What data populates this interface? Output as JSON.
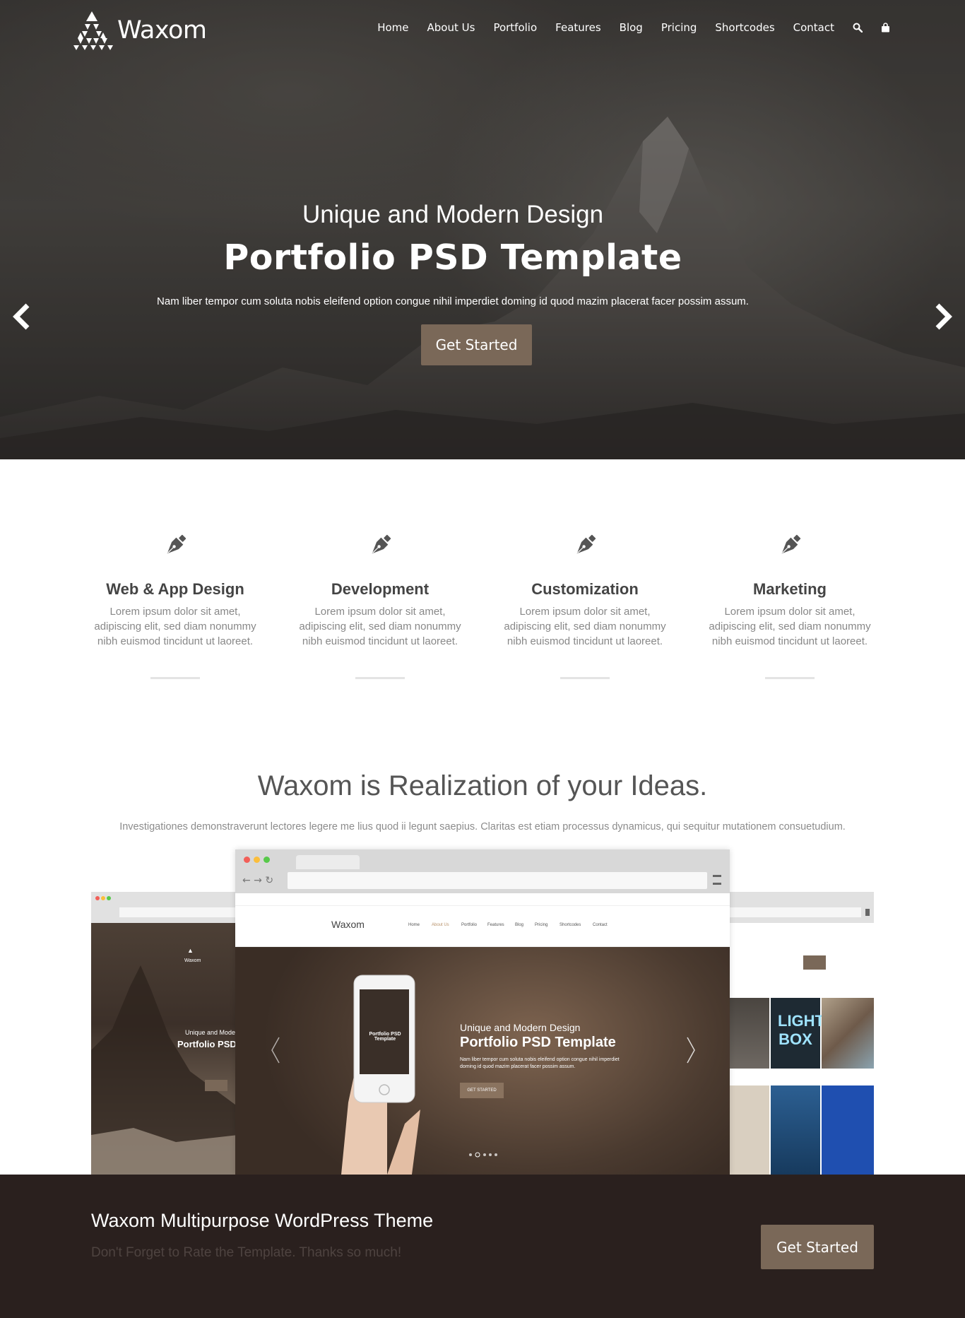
{
  "brand": {
    "name": "Waxom"
  },
  "nav": {
    "items": [
      "Home",
      "About Us",
      "Portfolio",
      "Features",
      "Blog",
      "Pricing",
      "Shortcodes",
      "Contact"
    ],
    "search_icon": "search-icon",
    "cart_icon": "shopping-bag-icon"
  },
  "hero": {
    "subtitle": "Unique and Modern Design",
    "title": "Portfolio PSD Template",
    "text": "Nam liber tempor cum soluta nobis eleifend option congue nihil imperdiet doming id quod mazim placerat facer possim assum.",
    "button": "Get Started",
    "prev_icon": "chevron-left-icon",
    "next_icon": "chevron-right-icon"
  },
  "features": [
    {
      "icon": "pen-nib-icon",
      "title": "Web & App Design",
      "desc": "Lorem ipsum dolor sit amet, adipiscing elit, sed diam nonummy nibh euismod tincidunt ut laoreet."
    },
    {
      "icon": "pen-nib-icon",
      "title": "Development",
      "desc": "Lorem ipsum dolor sit amet, adipiscing elit, sed diam nonummy nibh euismod tincidunt ut laoreet."
    },
    {
      "icon": "pen-nib-icon",
      "title": "Customization",
      "desc": "Lorem ipsum dolor sit amet, adipiscing elit, sed diam nonummy nibh euismod tincidunt ut laoreet."
    },
    {
      "icon": "pen-nib-icon",
      "title": "Marketing",
      "desc": "Lorem ipsum dolor sit amet, adipiscing elit, sed diam nonummy nibh euismod tincidunt ut laoreet."
    }
  ],
  "ideas": {
    "title": "Waxom is Realization of your Ideas.",
    "text": "Investigationes demonstraverunt lectores legere me lius quod ii legunt saepius. Claritas est etiam processus dynamicus, qui sequitur mutationem consuetudium."
  },
  "mockup": {
    "main": {
      "brand": "Waxom",
      "nav": [
        "Home",
        "About Us",
        "Portfolio",
        "Features",
        "Blog",
        "Pricing",
        "Shortcodes",
        "Contact"
      ],
      "subtitle": "Unique and Modern Design",
      "title": "Portfolio PSD Template",
      "text1": "Nam liber tempor cum soluta nobis eleifend option congue nihil imperdiet",
      "text2": "doming id quod mazim placerat facer possim assum.",
      "button": "GET STARTED",
      "phone_title": "Portfolio PSD Template"
    },
    "left": {
      "subtitle": "Unique and Modern De",
      "title": "Portfolio PSD Tem"
    },
    "right": {
      "tile": "LIGHT BOX"
    }
  },
  "cta": {
    "title": "Waxom Multipurpose WordPress Theme",
    "subtitle": "Don't Forget to Rate the Template. Thanks so much!",
    "button": "Get Started"
  },
  "colors": {
    "accent": "#7a6858",
    "dark": "#2a201e"
  }
}
